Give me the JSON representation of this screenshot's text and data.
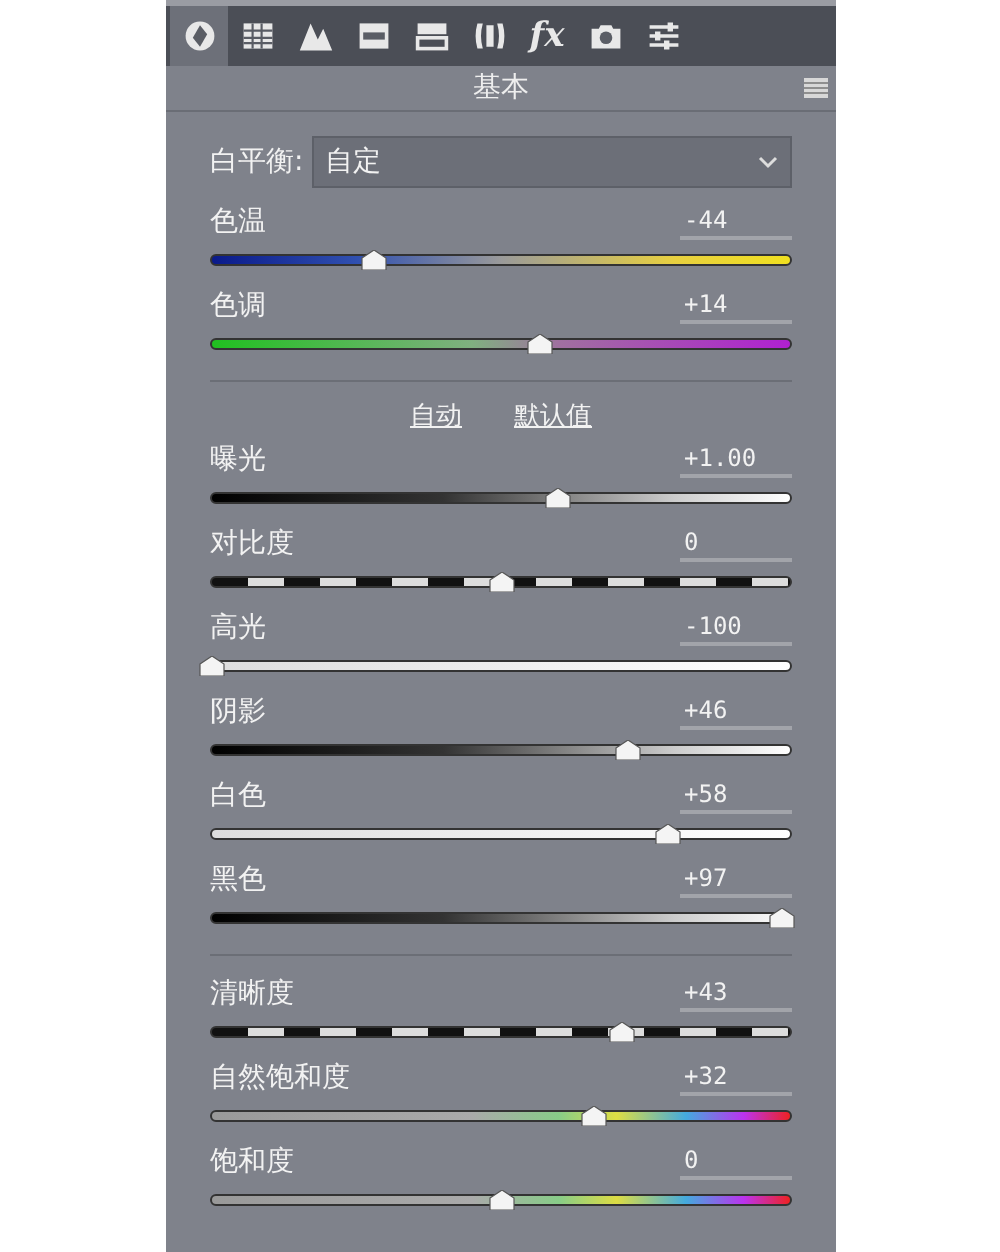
{
  "tabs": [
    {
      "kind": "aperture",
      "selected": true
    },
    {
      "kind": "grid",
      "selected": false
    },
    {
      "kind": "mountains",
      "selected": false
    },
    {
      "kind": "split",
      "selected": false
    },
    {
      "kind": "bars",
      "selected": false
    },
    {
      "kind": "lens",
      "selected": false
    },
    {
      "kind": "text",
      "label": "fx",
      "selected": false
    },
    {
      "kind": "camera",
      "selected": false
    },
    {
      "kind": "sliders",
      "selected": false
    }
  ],
  "panel_title": "基本",
  "white_balance": {
    "label": "白平衡:",
    "value": "自定"
  },
  "groups": [
    {
      "sliders": [
        {
          "name": "色温",
          "reading": "-44",
          "level": 0.28,
          "kind": "temp"
        },
        {
          "name": "色调",
          "reading": "+14",
          "level": 0.566,
          "kind": "tint"
        }
      ]
    },
    {
      "links": [
        "自动",
        "默认值"
      ],
      "sliders": [
        {
          "name": "曝光",
          "reading": "+1.00",
          "level": 0.6,
          "kind": "dark"
        },
        {
          "name": "对比度",
          "reading": "0",
          "level": 0.5,
          "kind": "dashed"
        },
        {
          "name": "高光",
          "reading": "-100",
          "level": 0,
          "kind": "light"
        },
        {
          "name": "阴影",
          "reading": "+46",
          "level": 0.72,
          "kind": "dark"
        },
        {
          "name": "白色",
          "reading": "+58",
          "level": 0.79,
          "kind": "light"
        },
        {
          "name": "黑色",
          "reading": "+97",
          "level": 0.985,
          "kind": "dark"
        }
      ]
    },
    {
      "sliders": [
        {
          "name": "清晰度",
          "reading": "+43",
          "level": 0.71,
          "kind": "dashed"
        },
        {
          "name": "自然饱和度",
          "reading": "+32",
          "level": 0.66,
          "kind": "spectrum"
        },
        {
          "name": "饱和度",
          "reading": "0",
          "level": 0.5,
          "kind": "spectrum"
        }
      ]
    }
  ]
}
